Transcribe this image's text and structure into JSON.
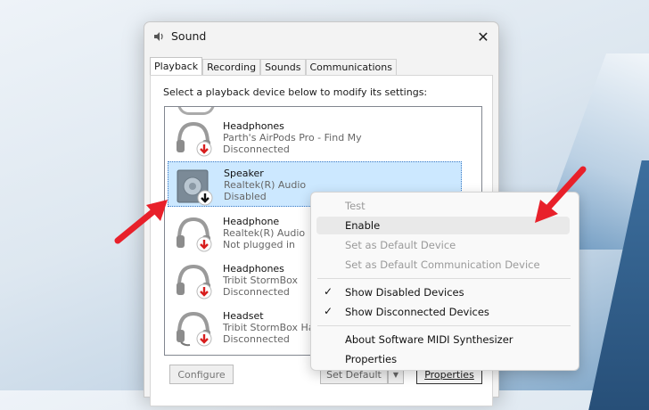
{
  "window": {
    "title": "Sound",
    "close_glyph": "✕"
  },
  "tabs": [
    {
      "label": "Playback",
      "active": true
    },
    {
      "label": "Recording"
    },
    {
      "label": "Sounds"
    },
    {
      "label": "Communications"
    }
  ],
  "instruction": "Select a playback device below to modify its settings:",
  "devices": [
    {
      "name": "Headphones",
      "sub": "Parth's AirPods Pro - Find My",
      "status": "Disconnected",
      "icon": "headphones-icon",
      "badge": "red-down-arrow"
    },
    {
      "name": "Speaker",
      "sub": "Realtek(R) Audio",
      "status": "Disabled",
      "icon": "speaker-icon",
      "badge": "black-down-arrow",
      "selected": true
    },
    {
      "name": "Headphone",
      "sub": "Realtek(R) Audio",
      "status": "Not plugged in",
      "icon": "headphones-icon",
      "badge": "red-down-arrow"
    },
    {
      "name": "Headphones",
      "sub": "Tribit StormBox",
      "status": "Disconnected",
      "icon": "headphones-icon",
      "badge": "red-down-arrow"
    },
    {
      "name": "Headset",
      "sub": "Tribit StormBox Hands-Free",
      "status": "Disconnected",
      "icon": "headset-icon",
      "badge": "red-down-arrow"
    }
  ],
  "buttons": {
    "configure": "Configure",
    "set_default": "Set Default",
    "properties": "Properties"
  },
  "context_menu": {
    "items": [
      {
        "label": "Test",
        "disabled": true
      },
      {
        "label": "Enable",
        "hover": true
      },
      {
        "label": "Set as Default Device",
        "disabled": true
      },
      {
        "label": "Set as Default Communication Device",
        "disabled": true
      },
      {
        "label": "Show Disabled Devices",
        "checked": true
      },
      {
        "label": "Show Disconnected Devices",
        "checked": true
      },
      {
        "label": "About Software MIDI Synthesizer"
      },
      {
        "label": "Properties"
      }
    ]
  },
  "colors": {
    "selection": "#cce8ff",
    "annotation_arrow": "#e8202a",
    "menu_hover": "#e9e9e9"
  }
}
